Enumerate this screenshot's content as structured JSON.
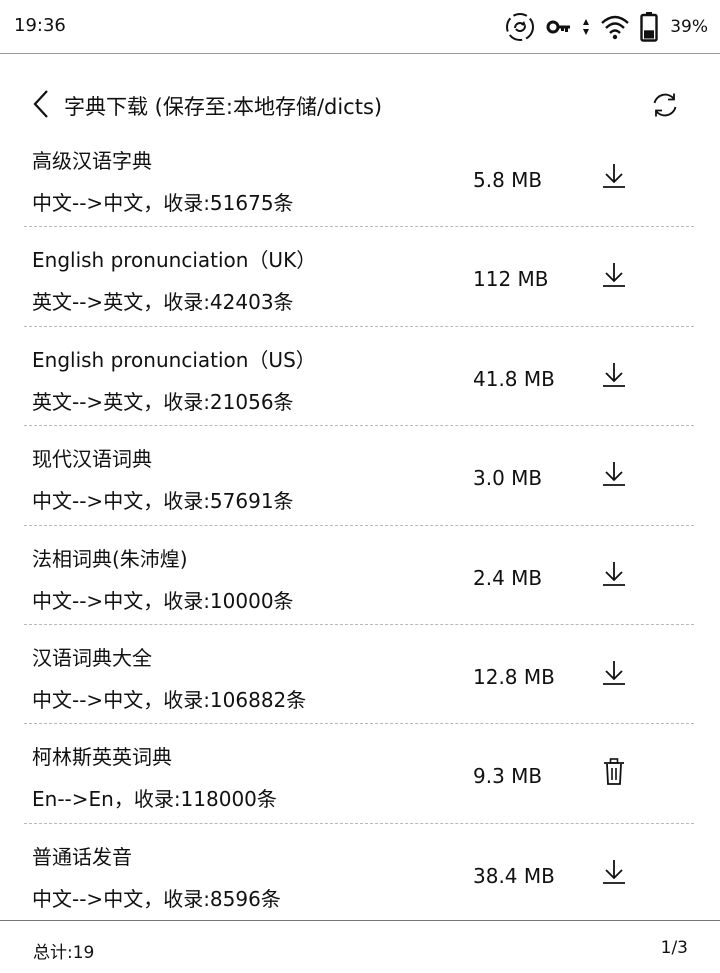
{
  "status_bar": {
    "time": "19:36",
    "battery_percent": "39%",
    "battery_level": 0.39,
    "icons": [
      "sync-icon",
      "key-icon",
      "data-arrows-icon",
      "wifi-icon",
      "battery-icon"
    ]
  },
  "header": {
    "title": "字典下载 (保存至:本地存储/dicts)",
    "back_icon": "chevron-left-icon",
    "refresh_icon": "refresh-icon"
  },
  "dictionaries": [
    {
      "name": "高级汉语字典",
      "info": "中文-->中文，收录:51675条",
      "size": "5.8 MB",
      "action": "download"
    },
    {
      "name": "English pronunciation（UK）",
      "info": "英文-->英文，收录:42403条",
      "size": "112 MB",
      "action": "download"
    },
    {
      "name": "English pronunciation（US）",
      "info": "英文-->英文，收录:21056条",
      "size": "41.8 MB",
      "action": "download"
    },
    {
      "name": "现代汉语词典",
      "info": "中文-->中文，收录:57691条",
      "size": "3.0 MB",
      "action": "download"
    },
    {
      "name": "法相词典(朱沛煌)",
      "info": "中文-->中文，收录:10000条",
      "size": "2.4 MB",
      "action": "download"
    },
    {
      "name": "汉语词典大全",
      "info": "中文-->中文，收录:106882条",
      "size": "12.8 MB",
      "action": "download"
    },
    {
      "name": "柯林斯英英词典",
      "info": "En-->En，收录:118000条",
      "size": "9.3 MB",
      "action": "delete"
    },
    {
      "name": "普通话发音",
      "info": "中文-->中文，收录:8596条",
      "size": "38.4 MB",
      "action": "download"
    }
  ],
  "footer": {
    "total": "总计:19",
    "page": "1/3"
  },
  "colors": {
    "text": "#111111",
    "divider": "#b8b8b8",
    "background": "#ffffff"
  }
}
